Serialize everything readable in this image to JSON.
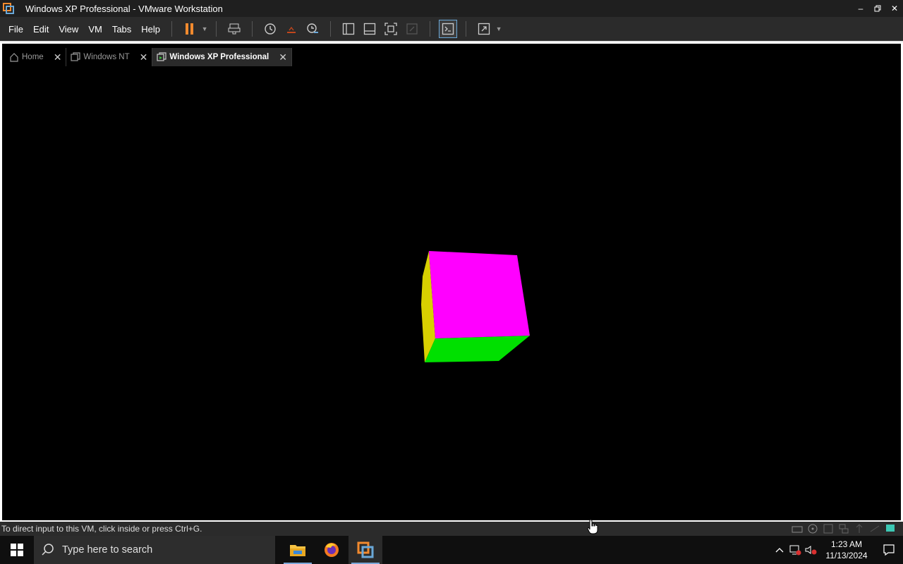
{
  "window": {
    "title": "Windows XP Professional - VMware Workstation",
    "min_icon": "minimize-icon",
    "max_icon": "restore-icon",
    "close_icon": "close-icon"
  },
  "menu": {
    "file": "File",
    "edit": "Edit",
    "view": "View",
    "vm": "VM",
    "tabs": "Tabs",
    "help": "Help"
  },
  "toolbar_icons": [
    "pause-icon",
    "send-ctrl-alt-del-icon",
    "snapshot-icon",
    "revert-snapshot-icon",
    "snapshot-manager-icon",
    "library-icon",
    "thumbnail-bar-icon",
    "full-screen-icon",
    "unity-icon",
    "console-view-icon",
    "stretch-icon"
  ],
  "tabs": [
    {
      "label": "Home",
      "icon": "home-icon"
    },
    {
      "label": "Windows NT",
      "icon": "vm-icon"
    },
    {
      "label": "Windows XP Professional",
      "icon": "vm-running-icon",
      "active": true
    }
  ],
  "vm_screen": {
    "cube_colors": {
      "top": "#ff00ff",
      "side": "#d8d000",
      "bottom": "#00e000"
    }
  },
  "statusbar": {
    "message": "To direct input to this VM, click inside or press Ctrl+G."
  },
  "taskbar": {
    "search_placeholder": "Type here to search",
    "apps": [
      "file-explorer-icon",
      "firefox-icon",
      "vmware-workstation-icon"
    ],
    "time": "1:23 AM",
    "date": "11/13/2024"
  },
  "colors": {
    "accent": "#f28a2e",
    "taskbar_highlight": "#7aa7d8"
  }
}
